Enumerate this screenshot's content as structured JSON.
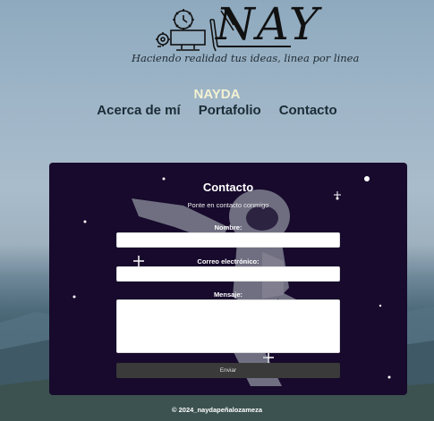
{
  "logo": {
    "wordmark": "NAY",
    "tagline": "Haciendo realidad tus ideas, linea por linea"
  },
  "brand": "NAYDA",
  "nav": {
    "items": [
      "Acerca de mí",
      "Portafolio",
      "Contacto"
    ]
  },
  "contact": {
    "title": "Contacto",
    "subtitle": "Ponte en contacto conmigo",
    "name_label": "Nombre:",
    "email_label": "Correo electrónico:",
    "message_label": "Mensaje:",
    "name_value": "",
    "email_value": "",
    "message_value": "",
    "submit_label": "Enviar"
  },
  "footer": "© 2024_naydapeñalozameza"
}
